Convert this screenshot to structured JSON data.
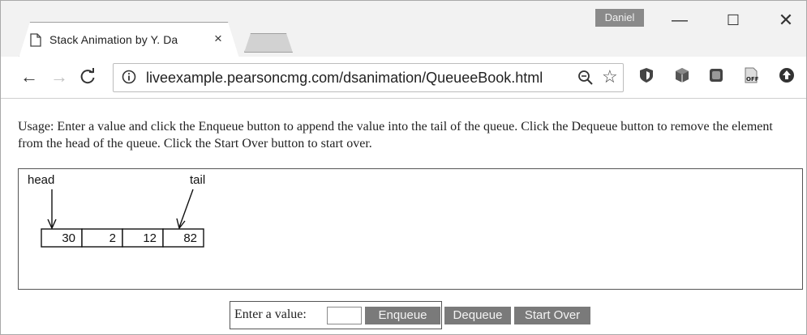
{
  "browser": {
    "tab_title": "Stack Animation by Y. Da",
    "tab_close": "×",
    "profile_name": "Daniel",
    "window_controls": {
      "minimize": "—",
      "maximize": "☐",
      "close": "✕"
    },
    "nav": {
      "back": "←",
      "forward": "→",
      "reload": "C"
    },
    "url": "liveexample.pearsoncmg.com/dsanimation/QueueeBook.html",
    "star": "☆",
    "extension_icons": [
      "shield-extension-icon",
      "cube-extension-icon",
      "square-extension-icon",
      "off-extension-icon",
      "upload-extension-icon"
    ],
    "extension_off_label": "OFF"
  },
  "page": {
    "usage_text": "Usage: Enter a value and click the Enqueue button to append the value into the tail of the queue. Click the Dequeue button to remove the element from the head of the queue. Click the Start Over button to start over.",
    "queue": {
      "head_label": "head",
      "tail_label": "tail",
      "values": [
        "30",
        "2",
        "12",
        "82"
      ]
    },
    "controls": {
      "prompt": "Enter a value:",
      "input_value": "",
      "enqueue_label": "Enqueue",
      "dequeue_label": "Dequeue",
      "startover_label": "Start Over"
    }
  },
  "colors": {
    "button_bg": "#7a7a7a",
    "titlebar_bg": "#f2f2f2"
  }
}
